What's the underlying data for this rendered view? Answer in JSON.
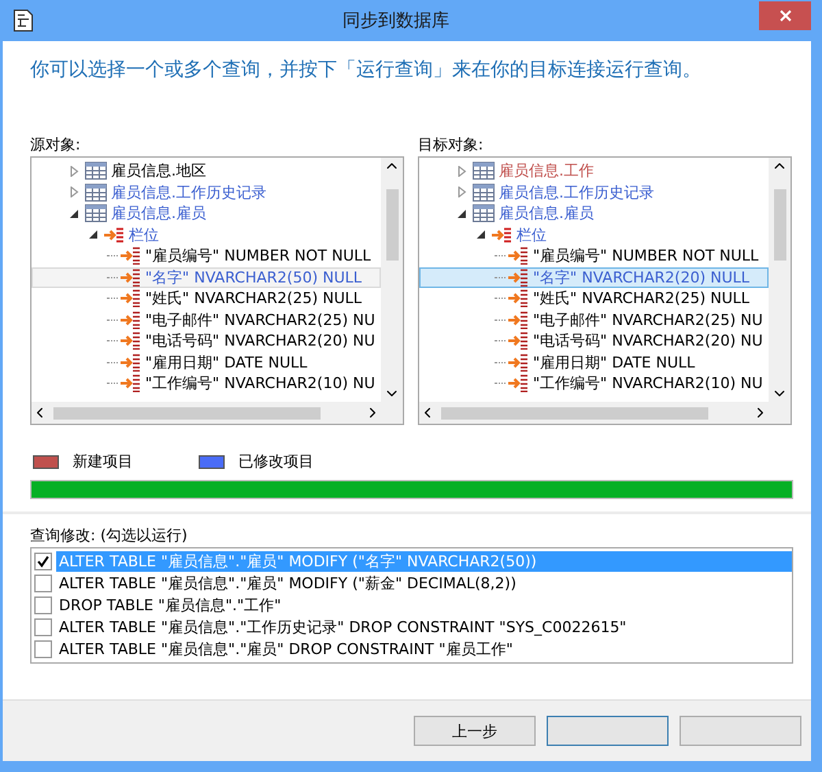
{
  "window": {
    "title": "同步到数据库"
  },
  "instruction": "你可以选择一个或多个查询，并按下「运行查询」来在你的目标连接运行查询。",
  "source": {
    "label": "源对象:",
    "focused": false,
    "nodes": [
      {
        "text": "雇员信息.地区",
        "kind": "table",
        "color": "#000000",
        "expanded": false,
        "selected": false
      },
      {
        "text": "雇员信息.工作历史记录",
        "kind": "table",
        "color": "#3b5fd0",
        "expanded": false,
        "selected": false
      },
      {
        "text": "雇员信息.雇员",
        "kind": "table",
        "color": "#3b5fd0",
        "expanded": true,
        "selected": false,
        "children": [
          {
            "text": "栏位",
            "kind": "folder",
            "color": "#3b5fd0",
            "expanded": true,
            "selected": false,
            "children": [
              {
                "text": "\"雇员编号\" NUMBER NOT NULL",
                "kind": "column",
                "color": "#000000",
                "selected": false
              },
              {
                "text": "\"名字\" NVARCHAR2(50) NULL",
                "kind": "column",
                "color": "#3b5fd0",
                "selected": true
              },
              {
                "text": "\"姓氏\" NVARCHAR2(25) NULL",
                "kind": "column",
                "color": "#000000",
                "selected": false
              },
              {
                "text": "\"电子邮件\" NVARCHAR2(25) NU",
                "kind": "column",
                "color": "#000000",
                "selected": false
              },
              {
                "text": "\"电话号码\" NVARCHAR2(20) NU",
                "kind": "column",
                "color": "#000000",
                "selected": false
              },
              {
                "text": "\"雇用日期\" DATE NULL",
                "kind": "column",
                "color": "#000000",
                "selected": false
              },
              {
                "text": "\"工作编号\" NVARCHAR2(10) NU",
                "kind": "column",
                "color": "#000000",
                "selected": false
              }
            ]
          }
        ]
      }
    ]
  },
  "target": {
    "label": "目标对象:",
    "focused": true,
    "nodes": [
      {
        "text": "雇员信息.工作",
        "kind": "table",
        "color": "#c0504d",
        "expanded": false,
        "selected": false
      },
      {
        "text": "雇员信息.工作历史记录",
        "kind": "table",
        "color": "#3b5fd0",
        "expanded": false,
        "selected": false
      },
      {
        "text": "雇员信息.雇员",
        "kind": "table",
        "color": "#3b5fd0",
        "expanded": true,
        "selected": false,
        "children": [
          {
            "text": "栏位",
            "kind": "folder",
            "color": "#3b5fd0",
            "expanded": true,
            "selected": false,
            "children": [
              {
                "text": "\"雇员编号\" NUMBER NOT NULL",
                "kind": "column",
                "color": "#000000",
                "selected": false
              },
              {
                "text": "\"名字\" NVARCHAR2(20) NULL",
                "kind": "column",
                "color": "#3b5fd0",
                "selected": true
              },
              {
                "text": "\"姓氏\" NVARCHAR2(25) NULL",
                "kind": "column",
                "color": "#000000",
                "selected": false
              },
              {
                "text": "\"电子邮件\" NVARCHAR2(25) NU",
                "kind": "column",
                "color": "#000000",
                "selected": false
              },
              {
                "text": "\"电话号码\" NVARCHAR2(20) NU",
                "kind": "column",
                "color": "#000000",
                "selected": false
              },
              {
                "text": "\"雇用日期\" DATE NULL",
                "kind": "column",
                "color": "#000000",
                "selected": false
              },
              {
                "text": "\"工作编号\" NVARCHAR2(10) NU",
                "kind": "column",
                "color": "#000000",
                "selected": false
              }
            ]
          }
        ]
      }
    ]
  },
  "legend": [
    {
      "label": "新建项目",
      "color": "#c0504d"
    },
    {
      "label": "已修改项目",
      "color": "#4a6cf7"
    }
  ],
  "progress": {
    "level": 1
  },
  "queries": {
    "label": "查询修改: (勾选以运行)",
    "items": [
      {
        "text": "ALTER TABLE \"雇员信息\".\"雇员\" MODIFY (\"名字\" NVARCHAR2(50))",
        "checked": true,
        "selected": true
      },
      {
        "text": "ALTER TABLE \"雇员信息\".\"雇员\" MODIFY (\"薪金\" DECIMAL(8,2))",
        "checked": false,
        "selected": false
      },
      {
        "text": "DROP TABLE \"雇员信息\".\"工作\"",
        "checked": false,
        "selected": false
      },
      {
        "text": "ALTER TABLE \"雇员信息\".\"工作历史记录\" DROP CONSTRAINT \"SYS_C0022615\"",
        "checked": false,
        "selected": false
      },
      {
        "text": "ALTER TABLE \"雇员信息\".\"雇员\" DROP CONSTRAINT \"雇员工作\"",
        "checked": false,
        "selected": false
      }
    ]
  },
  "buttons": [
    {
      "label": "上一步",
      "default": false
    },
    {
      "default": true
    },
    {
      "default": false
    }
  ]
}
